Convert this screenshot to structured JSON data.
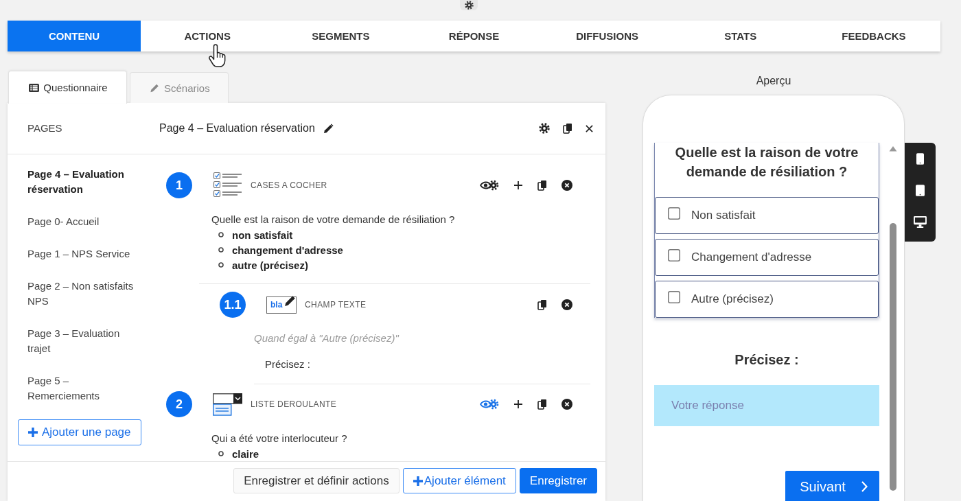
{
  "top_nav": [
    {
      "label": "CONTENU",
      "selected": true
    },
    {
      "label": "ACTIONS",
      "selected": false
    },
    {
      "label": "SEGMENTS",
      "selected": false
    },
    {
      "label": "RÉPONSE",
      "selected": false
    },
    {
      "label": "DIFFUSIONS",
      "selected": false
    },
    {
      "label": "STATS",
      "selected": false
    },
    {
      "label": "FEEDBACKS",
      "selected": false
    }
  ],
  "editor_tabs": [
    {
      "label": "Questionnaire",
      "selected": true
    },
    {
      "label": "Scénarios",
      "selected": false
    }
  ],
  "editor": {
    "pages_heading": "PAGES",
    "page_title": "Page 4 – Evaluation réservation",
    "pages": [
      {
        "label": "Page 4 – Evaluation réservation",
        "selected": true
      },
      {
        "label": "Page 0- Accueil",
        "selected": false
      },
      {
        "label": "Page 1 – NPS Service",
        "selected": false
      },
      {
        "label": "Page 2 – Non satisfaits NPS",
        "selected": false
      },
      {
        "label": "Page 3 – Evaluation trajet",
        "selected": false
      },
      {
        "label": "Page 5 – Remerciements",
        "selected": false
      }
    ],
    "add_page_button": "Ajouter une page",
    "questions": [
      {
        "number": "1",
        "kind": "checkboxes",
        "type_label": "CASES A COCHER",
        "visibility_rule": false,
        "text": "Quelle est la raison de votre demande de résiliation ?",
        "options": [
          "non satisfait",
          "changement d'adresse",
          "autre (précisez)"
        ],
        "children": [
          {
            "number": "1.1",
            "kind": "text_field",
            "type_label": "CHAMP TEXTE",
            "icon_text": "bla",
            "condition": "Quand égal à \"Autre (précisez)\"",
            "text": "Précisez :"
          }
        ]
      },
      {
        "number": "2",
        "kind": "dropdown",
        "type_label": "LISTE DEROULANTE",
        "visibility_rule": true,
        "text": "Qui a été votre interlocuteur ?",
        "options": [
          "claire"
        ]
      }
    ],
    "footer_buttons": [
      {
        "label": "Enregistrer et définir actions",
        "kind": "secondary"
      },
      {
        "label": "Ajouter élément",
        "kind": "add"
      },
      {
        "label": "Enregistrer",
        "kind": "primary"
      }
    ]
  },
  "preview": {
    "heading": "Aperçu",
    "question": "Quelle est la raison de votre demande de résiliation ?",
    "options": [
      {
        "label": "Non satisfait",
        "checked": false
      },
      {
        "label": "Changement d'adresse",
        "checked": false
      },
      {
        "label": "Autre (précisez)",
        "checked": false
      }
    ],
    "field": {
      "label": "Précisez :",
      "placeholder": "Votre réponse"
    },
    "next_button": "Suivant"
  }
}
